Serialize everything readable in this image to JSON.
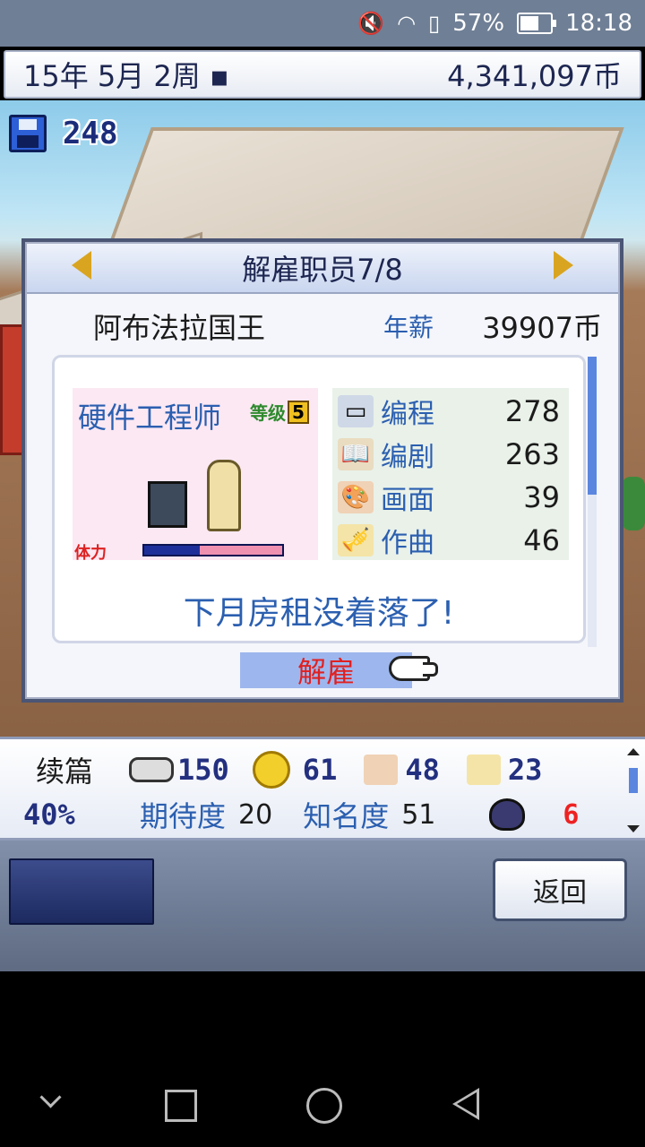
{
  "status_bar": {
    "battery": "57%",
    "time": "18:18",
    "icons": [
      "mute-icon",
      "wifi-icon",
      "sim-icon",
      "battery-icon"
    ]
  },
  "top_bar": {
    "date": "15年 5月 2周 ▪",
    "money": "4,341,097币"
  },
  "save": {
    "count": "248",
    "icon": "floppy-disk-icon"
  },
  "dialog": {
    "title": "解雇职员7/8",
    "employee_name": "阿布法拉国王",
    "salary_label": "年薪",
    "salary_value": "39907币",
    "job": "硬件工程师",
    "level_label": "等级",
    "level_value": "5",
    "stamina_label": "体力",
    "stamina_fraction": 0.4,
    "skills": [
      {
        "label": "编程",
        "value": "278",
        "icon": "computer-icon"
      },
      {
        "label": "编剧",
        "value": "263",
        "icon": "book-icon"
      },
      {
        "label": "画面",
        "value": "39",
        "icon": "paint-icon"
      },
      {
        "label": "作曲",
        "value": "46",
        "icon": "trumpet-icon"
      }
    ],
    "message": "下月房租没着落了!",
    "fire_label": "解雇"
  },
  "info_bar": {
    "sequel_label": "续篇",
    "sequel_pct": "40%",
    "fun": "150",
    "creativity": "61",
    "graphics": "48",
    "sound": "23",
    "expectation_label": "期待度",
    "expectation_value": "20",
    "fame_label": "知名度",
    "fame_value": "51",
    "bugs": "6"
  },
  "bottom": {
    "back_label": "返回"
  },
  "colors": {
    "accent_blue": "#2b5fb0",
    "fire_red": "#e02020",
    "header_navy": "#1d2650"
  }
}
